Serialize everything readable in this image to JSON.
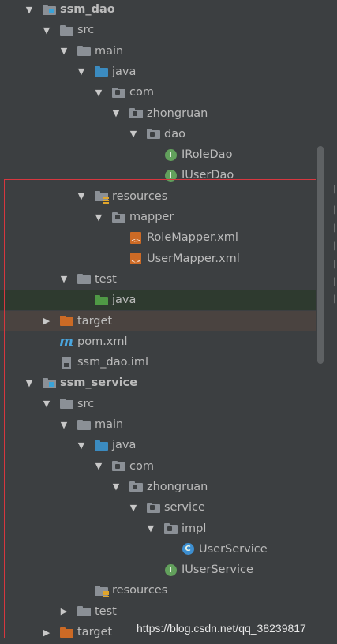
{
  "tree": [
    {
      "label": "ssm_dao",
      "depth": 0,
      "arrow": "down",
      "icon": "module-folder",
      "bold": true
    },
    {
      "label": "src",
      "depth": 1,
      "arrow": "down",
      "icon": "folder"
    },
    {
      "label": "main",
      "depth": 2,
      "arrow": "down",
      "icon": "folder"
    },
    {
      "label": "java",
      "depth": 3,
      "arrow": "down",
      "icon": "source-folder"
    },
    {
      "label": "com",
      "depth": 4,
      "arrow": "down",
      "icon": "package"
    },
    {
      "label": "zhongruan",
      "depth": 5,
      "arrow": "down",
      "icon": "package"
    },
    {
      "label": "dao",
      "depth": 6,
      "arrow": "down",
      "icon": "package"
    },
    {
      "label": "IRoleDao",
      "depth": 7,
      "arrow": "none",
      "icon": "interface"
    },
    {
      "label": "IUserDao",
      "depth": 7,
      "arrow": "none",
      "icon": "interface"
    },
    {
      "label": "resources",
      "depth": 3,
      "arrow": "down",
      "icon": "resources-folder"
    },
    {
      "label": "mapper",
      "depth": 4,
      "arrow": "down",
      "icon": "package"
    },
    {
      "label": "RoleMapper.xml",
      "depth": 5,
      "arrow": "none",
      "icon": "xml"
    },
    {
      "label": "UserMapper.xml",
      "depth": 5,
      "arrow": "none",
      "icon": "xml"
    },
    {
      "label": "test",
      "depth": 2,
      "arrow": "down",
      "icon": "folder"
    },
    {
      "label": "java",
      "depth": 3,
      "arrow": "none",
      "icon": "test-folder",
      "highlight": "green"
    },
    {
      "label": "target",
      "depth": 1,
      "arrow": "right",
      "icon": "excluded-folder",
      "highlight": "brown"
    },
    {
      "label": "pom.xml",
      "depth": 1,
      "arrow": "none",
      "icon": "maven"
    },
    {
      "label": "ssm_dao.iml",
      "depth": 1,
      "arrow": "none",
      "icon": "iml"
    },
    {
      "label": "ssm_service",
      "depth": 0,
      "arrow": "down",
      "icon": "module-folder",
      "bold": true
    },
    {
      "label": "src",
      "depth": 1,
      "arrow": "down",
      "icon": "folder"
    },
    {
      "label": "main",
      "depth": 2,
      "arrow": "down",
      "icon": "folder"
    },
    {
      "label": "java",
      "depth": 3,
      "arrow": "down",
      "icon": "source-folder"
    },
    {
      "label": "com",
      "depth": 4,
      "arrow": "down",
      "icon": "package"
    },
    {
      "label": "zhongruan",
      "depth": 5,
      "arrow": "down",
      "icon": "package"
    },
    {
      "label": "service",
      "depth": 6,
      "arrow": "down",
      "icon": "package"
    },
    {
      "label": "impl",
      "depth": 7,
      "arrow": "down",
      "icon": "package"
    },
    {
      "label": "UserService",
      "depth": 8,
      "arrow": "none",
      "icon": "class"
    },
    {
      "label": "IUserService",
      "depth": 7,
      "arrow": "none",
      "icon": "interface"
    },
    {
      "label": "resources",
      "depth": 3,
      "arrow": "none",
      "icon": "resources-folder"
    },
    {
      "label": "test",
      "depth": 2,
      "arrow": "right",
      "icon": "folder"
    },
    {
      "label": "target",
      "depth": 1,
      "arrow": "right",
      "icon": "excluded-folder"
    }
  ],
  "watermark": "https://blog.csdn.net/qq_38239817",
  "colors": {
    "background": "#3c3f41",
    "text": "#bbbbbb",
    "highlight_box": "#d7373f"
  }
}
